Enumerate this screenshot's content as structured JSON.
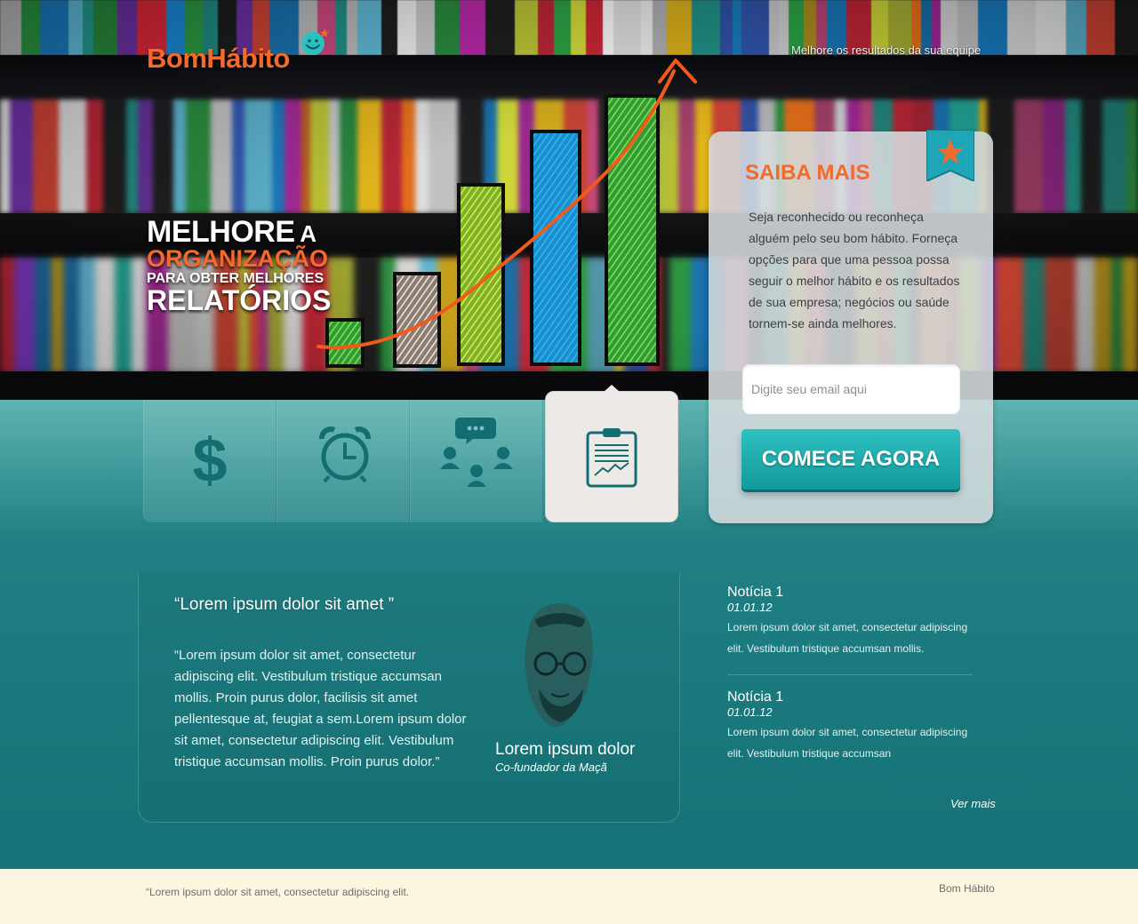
{
  "header": {
    "logo_part1": "Bom",
    "logo_part2": "Hábito",
    "tagline": "Melhore os resultados da sua equipe"
  },
  "hero": {
    "line1_big": "MELHORE",
    "line1_small": " A",
    "line2": "ORGANIZAÇÃO",
    "line3": "PARA OBTER MELHORES",
    "line4": "RELATÓRIOS"
  },
  "features": [
    {
      "icon": "dollar-icon",
      "active": false
    },
    {
      "icon": "alarm-clock-icon",
      "active": false
    },
    {
      "icon": "team-chat-icon",
      "active": false
    },
    {
      "icon": "clipboard-report-icon",
      "active": true
    }
  ],
  "signup": {
    "title": "SAIBA MAIS",
    "text": "Seja reconhecido ou reconheça alguém pelo seu bom hábito. Forneça opções para que uma pessoa possa seguir o melhor hábito e os resultados de sua empresa; negócios ou saúde tornem-se ainda melhores.",
    "email_placeholder": "Digite seu email aqui",
    "button": "COMECE AGORA"
  },
  "testimonial": {
    "title": "“Lorem ipsum dolor sit amet ”",
    "body": "“Lorem ipsum dolor sit amet, consectetur adipiscing elit. Vestibulum tristique accumsan mollis. Proin purus dolor, facilisis sit amet pellentesque at, feugiat a sem.Lorem ipsum dolor sit amet, consectetur adipiscing elit. Vestibulum tristique accumsan mollis. Proin purus dolor.”",
    "name": "Lorem ipsum dolor",
    "role": "Co-fundador da Maçã"
  },
  "news": {
    "items": [
      {
        "title": "Notícia 1",
        "date": "01.01.12",
        "text": "Lorem ipsum dolor sit amet, consectetur adipiscing elit. Vestibulum tristique accumsan mollis."
      },
      {
        "title": "Notícia 1",
        "date": "01.01.12",
        "text": "Lorem ipsum dolor sit amet, consectetur adipiscing elit. Vestibulum tristique accumsan"
      }
    ],
    "more": "Ver mais"
  },
  "footer": {
    "text": "“Lorem ipsum dolor sit amet, consectetur adipiscing elit.",
    "brand": "Bom Hábito"
  },
  "colors": {
    "accent": "#f26a2c",
    "teal": "#1f8f91",
    "footer_bg": "#fcf6e0"
  }
}
